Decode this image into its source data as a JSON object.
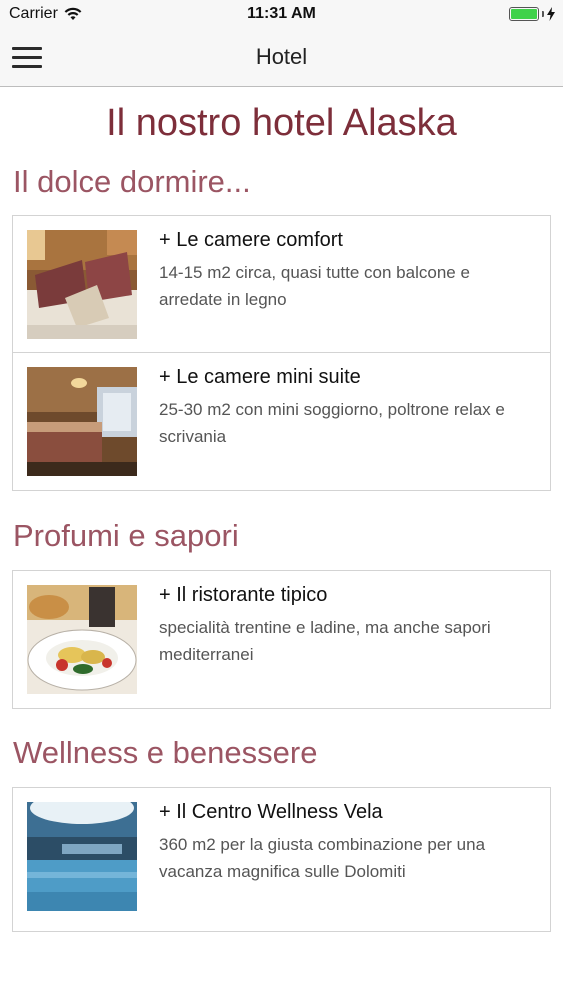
{
  "status_bar": {
    "carrier": "Carrier",
    "time": "11:31 AM"
  },
  "nav": {
    "title": "Hotel"
  },
  "page_title": "Il nostro hotel Alaska",
  "sections": [
    {
      "heading": "Il dolce dormire...",
      "items": [
        {
          "title": "+ Le camere comfort",
          "description": "14-15 m2 circa, quasi tutte con balcone e arredate in legno",
          "image": "room-comfort-photo"
        },
        {
          "title": "+ Le camere mini suite",
          "description": "25-30 m2 con mini soggiorno, poltrone relax e scrivania",
          "image": "room-mini-suite-photo"
        }
      ]
    },
    {
      "heading": "Profumi e sapori",
      "items": [
        {
          "title": "+ Il ristorante tipico",
          "description": "specialità trentine e ladine, ma anche sapori mediterranei",
          "image": "restaurant-dish-photo"
        }
      ]
    },
    {
      "heading": "Wellness e benessere",
      "items": [
        {
          "title": "+ Il Centro Wellness Vela",
          "description": "360 m2 per la giusta combinazione per una vacanza magnifica sulle Dolomiti",
          "image": "wellness-pool-photo"
        }
      ]
    }
  ],
  "colors": {
    "title": "#7d2e3a",
    "section_heading": "#9b5563",
    "battery": "#3fd24a"
  }
}
